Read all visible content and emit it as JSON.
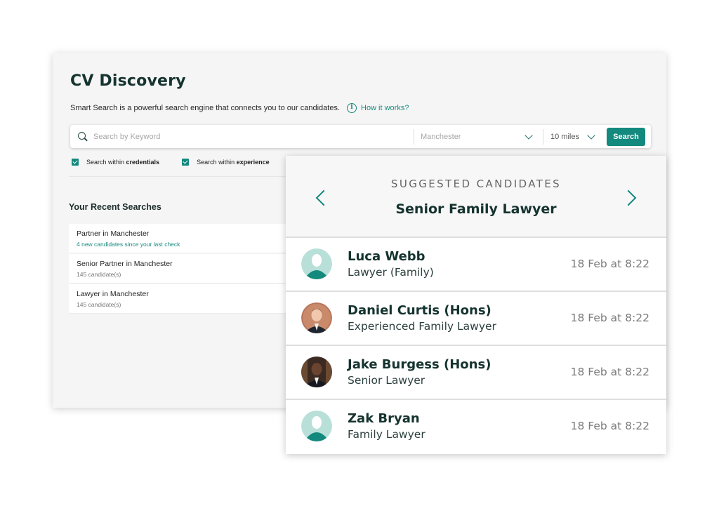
{
  "main": {
    "title": "CV Discovery",
    "subtitle": "Smart Search is a powerful search engine that connects you to our candidates.",
    "how_link": "How it works?"
  },
  "search": {
    "keyword_placeholder": "Search by Keyword",
    "location": "Manchester",
    "radius": "10 miles",
    "button": "Search"
  },
  "filters": [
    {
      "prefix": "Search within ",
      "bold": "credentials",
      "checked": true
    },
    {
      "prefix": "Search within ",
      "bold": "experience",
      "checked": true
    }
  ],
  "recent": {
    "title": "Your Recent Searches",
    "items": [
      {
        "name": "Partner in Manchester",
        "meta": "4 new candidates since your last check"
      },
      {
        "name": "Senior Partner in Manchester",
        "meta": "145 candidate(s)"
      },
      {
        "name": "Lawyer in Manchester",
        "meta": "145 candidate(s)"
      }
    ]
  },
  "suggested": {
    "label": "SUGGESTED CANDIDATES",
    "title": "Senior Family Lawyer",
    "candidates": [
      {
        "name": "Luca Webb",
        "role": "Lawyer (Family)",
        "time": "18 Feb at 8:22",
        "avatar": "placeholder-avatar-icon"
      },
      {
        "name": "Daniel Curtis (Hons)",
        "role": "Experienced Family Lawyer",
        "time": "18 Feb at 8:22",
        "avatar": "photo"
      },
      {
        "name": "Jake Burgess (Hons)",
        "role": "Senior Lawyer",
        "time": "18 Feb at 8:22",
        "avatar": "photo"
      },
      {
        "name": "Zak Bryan",
        "role": "Family Lawyer",
        "time": "18 Feb at 8:22",
        "avatar": "placeholder-avatar-icon"
      }
    ]
  },
  "colors": {
    "accent": "#14897e",
    "heading": "#15332f",
    "avatar_bg": "#b9e0d8"
  }
}
